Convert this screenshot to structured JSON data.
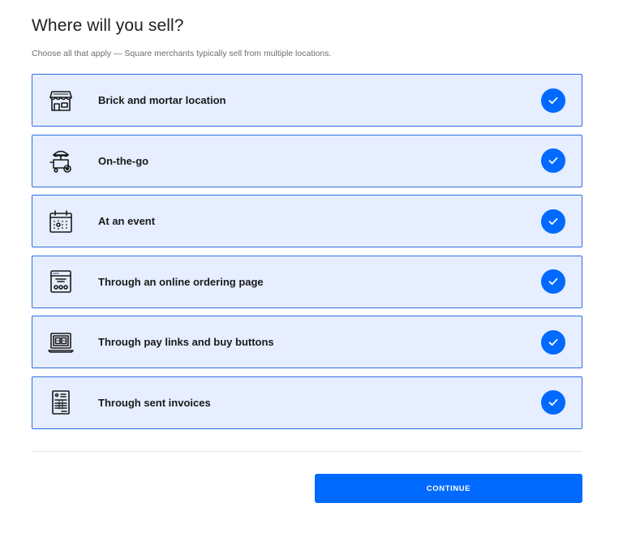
{
  "header": {
    "title": "Where will you sell?",
    "subtitle": "Choose all that apply — Square merchants typically sell from multiple locations."
  },
  "options": [
    {
      "label": "Brick and mortar location",
      "icon": "storefront-icon",
      "selected": true
    },
    {
      "label": "On-the-go",
      "icon": "food-cart-icon",
      "selected": true
    },
    {
      "label": "At an event",
      "icon": "calendar-event-icon",
      "selected": true
    },
    {
      "label": "Through an online ordering page",
      "icon": "online-ordering-icon",
      "selected": true
    },
    {
      "label": "Through pay links and buy buttons",
      "icon": "laptop-icon",
      "selected": true
    },
    {
      "label": "Through sent invoices",
      "icon": "invoice-icon",
      "selected": true
    }
  ],
  "footer": {
    "continue_label": "CONTINUE"
  },
  "colors": {
    "accent": "#006aff",
    "option_bg": "#e6eeff",
    "option_border": "#2f6fe0"
  }
}
